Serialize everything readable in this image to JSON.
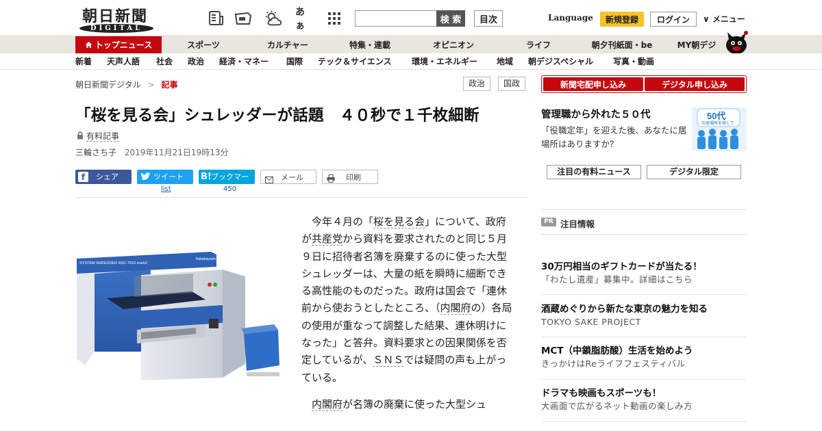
{
  "header": {
    "logo_kanji": "朝日新聞",
    "logo_sub": "DIGITAL",
    "search_placeholder": "",
    "search_label": "検 索",
    "toc_label": "目次",
    "language_label": "Language",
    "register_label": "新規登録",
    "login_label": "ログイン",
    "menu_label": "∨ メニュー",
    "kana_icon_label": "あぁ"
  },
  "nav_main": [
    {
      "label": "トップニュース"
    },
    {
      "label": "スポーツ"
    },
    {
      "label": "カルチャー"
    },
    {
      "label": "特集・連載"
    },
    {
      "label": "オピニオン"
    },
    {
      "label": "ライフ"
    },
    {
      "label": "朝夕刊紙面・be"
    },
    {
      "label": "MY朝デジ"
    }
  ],
  "nav_sub": [
    {
      "label": "新着"
    },
    {
      "label": "天声人語"
    },
    {
      "label": "社会"
    },
    {
      "label": "政治"
    },
    {
      "label": "経済・マネー"
    },
    {
      "label": "国際"
    },
    {
      "label": "テック＆サイエンス"
    },
    {
      "label": "環境・エネルギー"
    },
    {
      "label": "地域"
    },
    {
      "label": "朝デジスペシャル"
    },
    {
      "label": "写真・動画"
    }
  ],
  "breadcrumb": {
    "root": "朝日新聞デジタル",
    "separator": ">",
    "current": "記事"
  },
  "tags": [
    "政治",
    "国政"
  ],
  "article": {
    "title": "「桜を見る会」シュレッダーが話題　４０秒で１千枚細断",
    "paid_label": "有料記事",
    "author": "三輪さち子",
    "date": "2019年11月21日19時13分",
    "photo_label": "SYSTEM SHREDDER NSC-7010 mark2",
    "photo_brand": "Nakabayashi",
    "p1": [
      "今年４月の「",
      "桜を見る会",
      "」について、政府が",
      "共産党",
      "から資料を要求されたのと同じ５月９日に招待者名簿を廃棄するのに使った大型シュレッダーは、大量の紙を瞬時に細断できる高性能のものだった。政府は国会で「連休前から使おうとしたところ、（",
      "内閣府",
      "の）各局の使用が重なって調整した結果、連休明けになった」と答弁。資料要求との因果関係を否定しているが、",
      "ＳＮＳ",
      "では疑問の声も上がっている。"
    ],
    "p2": [
      "内閣府",
      "が名簿の廃棄に使った大型シュ"
    ]
  },
  "share": {
    "facebook": "シェア",
    "twitter": "ツイート",
    "twitter_count": "list",
    "hatena": "ブックマーク",
    "hatena_count": "450",
    "mail": "メール",
    "print": "印刷"
  },
  "sidebar": {
    "subscribe_paper": "新聞宅配申し込み",
    "subscribe_digital": "デジタル申し込み",
    "promo_title": "管理職から外れた５０代",
    "promo_text": "「役職定年」を迎えた後、あなたに居場所はありますか？",
    "promo_image_text": "50代",
    "promo_image_sub": "の居場所を探して",
    "tab_paid": "注目の有料ニュース",
    "tab_digital": "デジタル限定",
    "pr_badge": "PR",
    "pr_heading": "注目情報",
    "pr_items": [
      {
        "title": "30万円相当のギフトカードが当たる！",
        "sub": "「わたし遺産」募集中。詳細はこちら"
      },
      {
        "title": "酒蔵めぐりから新たな東京の魅力を知る",
        "sub": "TOKYO SAKE PROJECT"
      },
      {
        "title": "MCT（中鎖脂肪酸）生活を始めよう",
        "sub": "きっかけはReライフフェスティバル"
      },
      {
        "title": "ドラマも映画もスポーツも！",
        "sub": "大画面で広がるネット動画の楽しみ方"
      }
    ]
  },
  "colors": {
    "brand_red": "#c4080e",
    "register_yellow": "#f6c22a",
    "facebook": "#3b5998",
    "twitter": "#1da1f2",
    "hatena": "#00a4de"
  }
}
